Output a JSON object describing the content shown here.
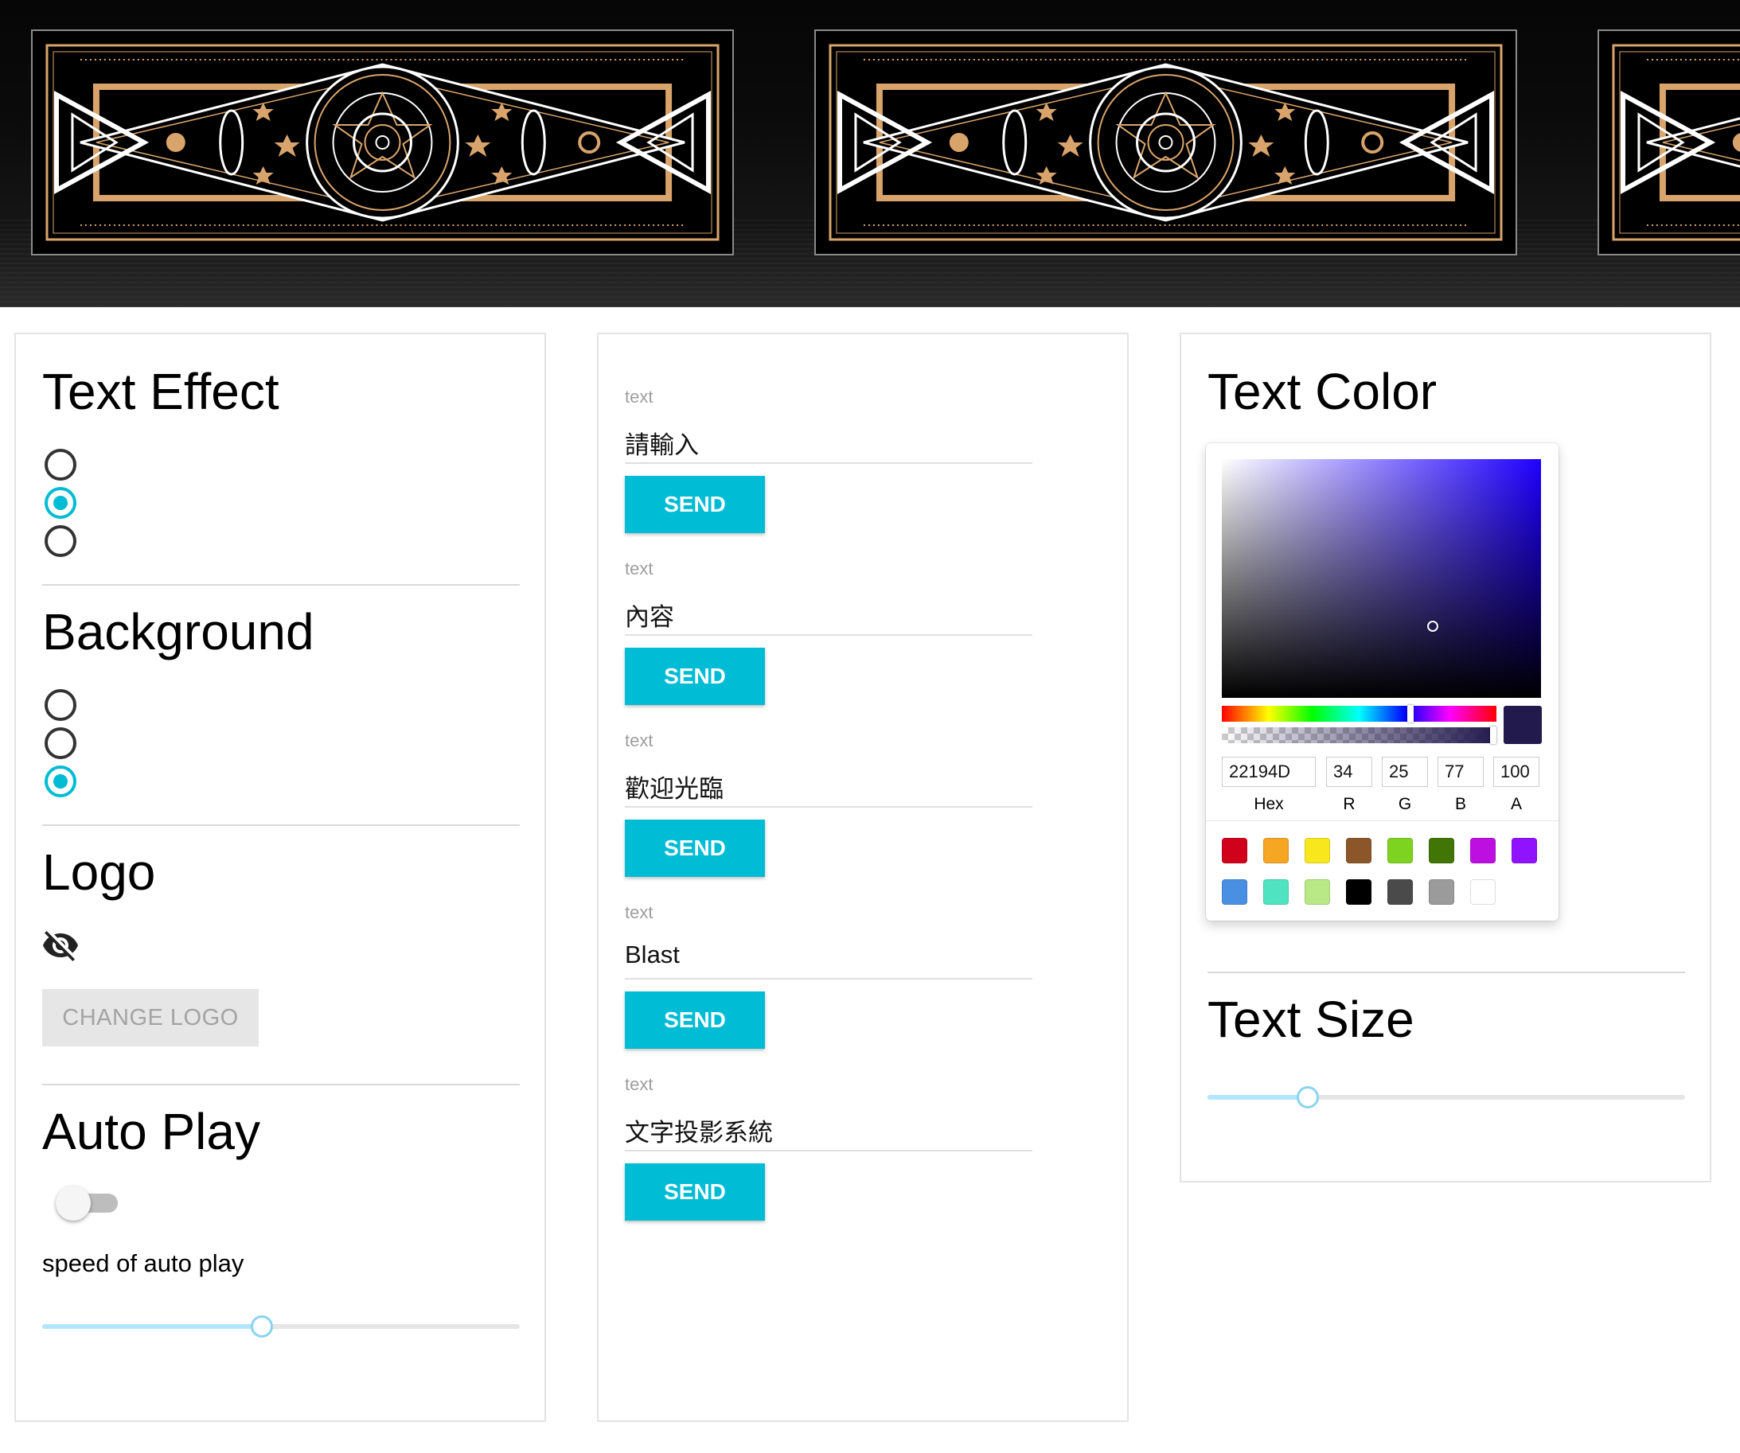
{
  "card1": {
    "text_effect": {
      "title": "Text Effect",
      "options": [
        false,
        true,
        false
      ]
    },
    "background": {
      "title": "Background",
      "options": [
        false,
        false,
        true
      ]
    },
    "logo": {
      "title": "Logo",
      "visibility_icon": "visibility-off-icon",
      "change_button": "CHANGE LOGO"
    },
    "auto_play": {
      "title": "Auto Play",
      "enabled": false,
      "speed_label": "speed of auto play",
      "speed_value": 0.46
    }
  },
  "card2": {
    "fields": [
      {
        "label": "text",
        "value": "請輸入",
        "button": "SEND"
      },
      {
        "label": "text",
        "value": "內容",
        "button": "SEND"
      },
      {
        "label": "text",
        "value": "歡迎光臨",
        "button": "SEND"
      },
      {
        "label": "text",
        "value": "Blast",
        "button": "SEND"
      },
      {
        "label": "text",
        "value": "文字投影系統",
        "button": "SEND"
      }
    ]
  },
  "card3": {
    "text_color": {
      "title": "Text Color",
      "hex": "22194D",
      "r": "34",
      "g": "25",
      "b": "77",
      "a": "100",
      "labels": {
        "hex": "Hex",
        "r": "R",
        "g": "G",
        "b": "B",
        "a": "A"
      },
      "current_color": "#22194d",
      "presets": [
        "#d0021b",
        "#f5a623",
        "#f8e71c",
        "#8b572a",
        "#7ed321",
        "#417505",
        "#bd10e0",
        "#9013fe",
        "#4a90e2",
        "#50e3c2",
        "#b8e986",
        "#000000",
        "#4a4a4a",
        "#9b9b9b",
        "#ffffff"
      ]
    },
    "text_size": {
      "title": "Text Size",
      "value": 0.21
    }
  },
  "colors": {
    "accent": "#00bcd4",
    "slider_fill": "#b3e5fc",
    "gold": "#d9a46c"
  }
}
